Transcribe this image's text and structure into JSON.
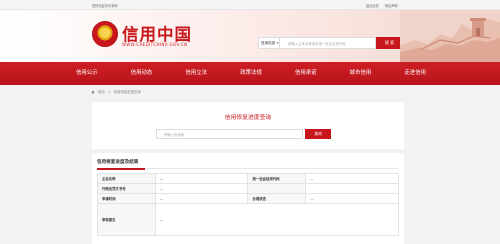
{
  "topbar": {
    "welcome": "您好欢迎访问本网",
    "links": [
      "建议反馈",
      "网站声明"
    ]
  },
  "header": {
    "site_title": "信用中国",
    "site_url": "WWW.CREDITCHINA.GOV.CN",
    "search_scope": "信用信息",
    "search_placeholder": "请输入主体名称或查询一社会信用代码",
    "search_button": "搜 索"
  },
  "nav": {
    "items": [
      "信用公示",
      "信用动态",
      "信用立法",
      "政策法规",
      "信用承诺",
      "城市信用",
      "走进信用"
    ]
  },
  "breadcrumb": {
    "home": "首页",
    "separator": ">",
    "current": "信用修复进度查询"
  },
  "query": {
    "title": "信用修复进度查询",
    "placeholder": "请输入查询码",
    "button": "查询"
  },
  "results": {
    "title": "信用修复进度及结果",
    "rows": [
      [
        {
          "label": "企业名称",
          "value": "—"
        },
        {
          "label": "统一社会信用代码",
          "value": "—"
        }
      ],
      [
        {
          "label": "行政处罚文书号",
          "value": "—"
        },
        {
          "label": "",
          "value": ""
        }
      ],
      [
        {
          "label": "申请时间",
          "value": "—"
        },
        {
          "label": "办理状态",
          "value": "—"
        }
      ]
    ],
    "opinion_label": "审核意见",
    "opinion_value": "—"
  },
  "colors": {
    "brand_red": "#c8161d",
    "nav_red": "#cf1e25",
    "page_bg": "#f2f2f2"
  }
}
